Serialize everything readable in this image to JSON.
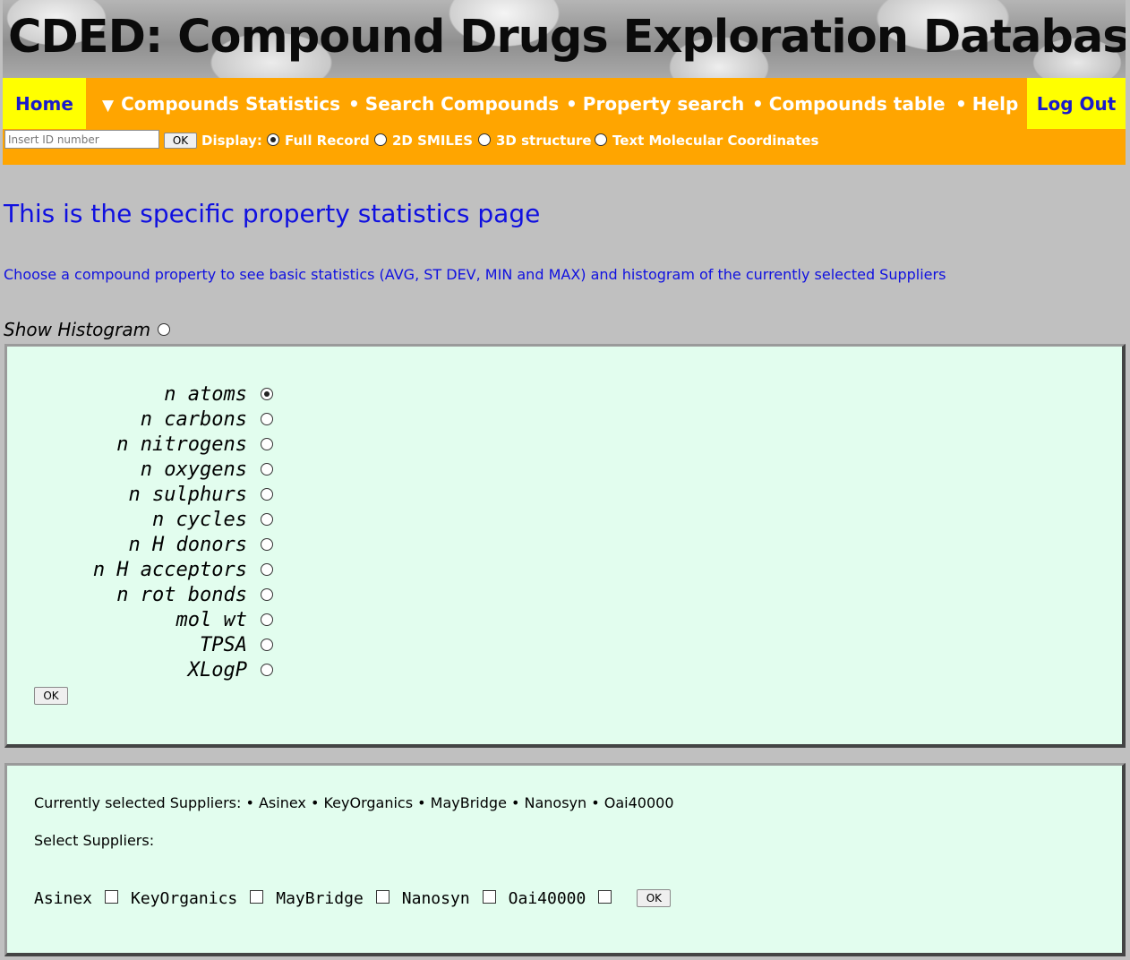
{
  "header": {
    "title": "CDED: Compound Drugs Exploration Database"
  },
  "nav": {
    "home": "Home",
    "compounds_statistics": "Compounds Statistics",
    "search_compounds": "Search Compounds",
    "property_search": "Property search",
    "compounds_table": "Compounds table",
    "help": "Help",
    "logout": "Log Out",
    "bullet": "•",
    "triangle": "▼",
    "id_input": {
      "value": "",
      "placeholder": "Insert ID number"
    },
    "ok_label": "OK",
    "display_label": "Display:",
    "display_options": [
      {
        "label": "Full Record",
        "selected": true
      },
      {
        "label": "2D SMILES",
        "selected": false
      },
      {
        "label": "3D structure",
        "selected": false
      },
      {
        "label": "Text Molecular Coordinates",
        "selected": false
      }
    ]
  },
  "page": {
    "title": "This is the specific property statistics page",
    "description": "Choose a compound property to see basic statistics (AVG, ST DEV, MIN and MAX) and histogram of the currently selected Suppliers",
    "show_histogram_label": "Show Histogram",
    "show_histogram_checked": false
  },
  "properties": {
    "items": [
      {
        "label": "n atoms",
        "selected": true
      },
      {
        "label": "n carbons",
        "selected": false
      },
      {
        "label": "n nitrogens",
        "selected": false
      },
      {
        "label": "n oxygens",
        "selected": false
      },
      {
        "label": "n sulphurs",
        "selected": false
      },
      {
        "label": "n cycles",
        "selected": false
      },
      {
        "label": "n H donors",
        "selected": false
      },
      {
        "label": "n H acceptors",
        "selected": false
      },
      {
        "label": "n rot bonds",
        "selected": false
      },
      {
        "label": "mol wt",
        "selected": false
      },
      {
        "label": "TPSA",
        "selected": false
      },
      {
        "label": "XLogP",
        "selected": false
      }
    ],
    "ok_label": "OK"
  },
  "suppliers": {
    "current_label": "Currently selected Suppliers: • Asinex • KeyOrganics • MayBridge • Nanosyn • Oai40000",
    "select_label": "Select Suppliers:",
    "items": [
      {
        "label": "Asinex",
        "checked": false
      },
      {
        "label": "KeyOrganics",
        "checked": false
      },
      {
        "label": "MayBridge",
        "checked": false
      },
      {
        "label": "Nanosyn",
        "checked": false
      },
      {
        "label": "Oai40000",
        "checked": false
      }
    ],
    "ok_label": "OK"
  }
}
